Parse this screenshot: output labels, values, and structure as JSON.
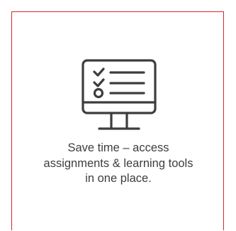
{
  "card": {
    "icon": "computer-monitor-checklist-icon",
    "caption_lines": [
      "Save time – access",
      "assignments & learning tools",
      "in one place."
    ]
  },
  "colors": {
    "border": "#d9252f",
    "icon": "#3d3d3d",
    "text": "#3d3d3d",
    "background": "#ffffff"
  }
}
